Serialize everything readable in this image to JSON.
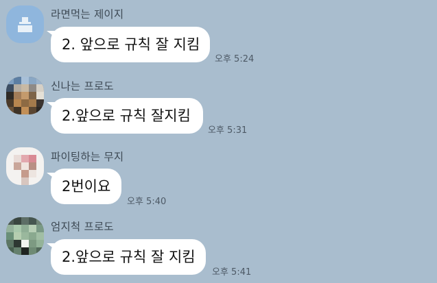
{
  "messages": [
    {
      "sender": "라면먹는 제이지",
      "text": "2. 앞으로 규칙 잘 지킴",
      "time": "오후 5:24"
    },
    {
      "sender": "신나는 프로도",
      "text": "2.앞으로 규칙 잘지킴",
      "time": "오후 5:31"
    },
    {
      "sender": "파이팅하는 무지",
      "text": "2번이요",
      "time": "오후 5:40"
    },
    {
      "sender": "엄지척 프로도",
      "text": "2.앞으로 규칙 잘 지킴",
      "time": "오후 5:41"
    }
  ],
  "colors": {
    "background": "#a9bdce",
    "bubble": "#ffffff",
    "default_avatar": "#8fb6dd"
  }
}
